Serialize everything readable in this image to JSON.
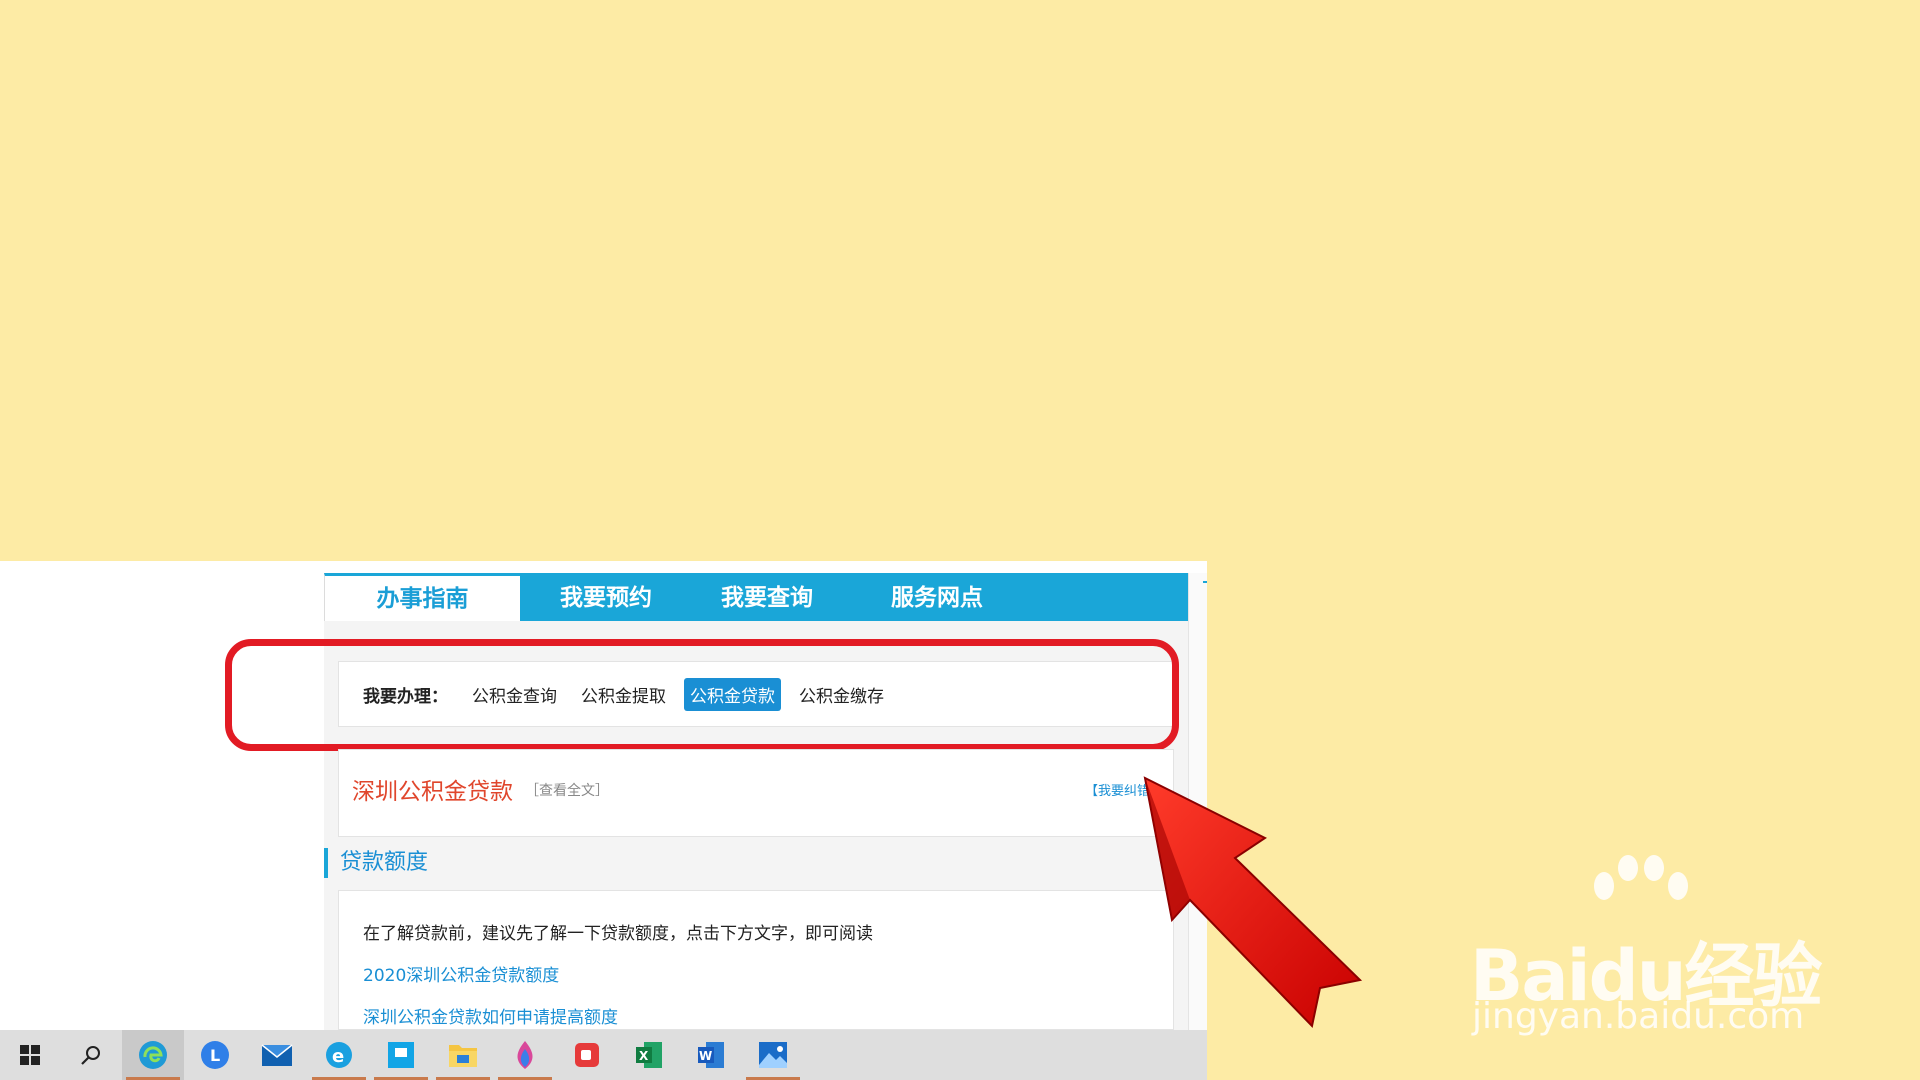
{
  "tabs": [
    "办事指南",
    "我要预约",
    "我要查询",
    "服务网点"
  ],
  "panel": {
    "label": "我要办理：",
    "options": [
      "公积金查询",
      "公积金提取",
      "公积金贷款",
      "公积金缴存"
    ],
    "selected": "公积金贷款"
  },
  "article": {
    "title": "深圳公积金贷款",
    "view_full": "［查看全文］",
    "report_error": "【我要纠错】"
  },
  "section": {
    "heading": "贷款额度",
    "intro": "在了解贷款前，建议先了解一下贷款额度，点击下方文字，即可阅读",
    "links": [
      "2020深圳公积金贷款额度",
      "深圳公积金贷款如何申请提高额度"
    ]
  },
  "watermark": {
    "brand": "Baidu经验",
    "url": "jingyan.baidu.com"
  },
  "taskbar": {
    "icons": [
      "windows-start-icon",
      "search-icon",
      "edge-icon",
      "l-app-icon",
      "mail-icon",
      "ie-icon",
      "app-icon",
      "file-explorer-icon",
      "paint-icon",
      "screen-recorder-icon",
      "excel-icon",
      "word-icon",
      "photos-icon"
    ]
  },
  "colors": {
    "background": "#fdeba5",
    "tab_bar": "#1aa6d8",
    "selected_option": "#1a8fd4",
    "highlight_box": "#e21b24",
    "arrow": "#e00f0f",
    "title_red": "#e0462c"
  }
}
